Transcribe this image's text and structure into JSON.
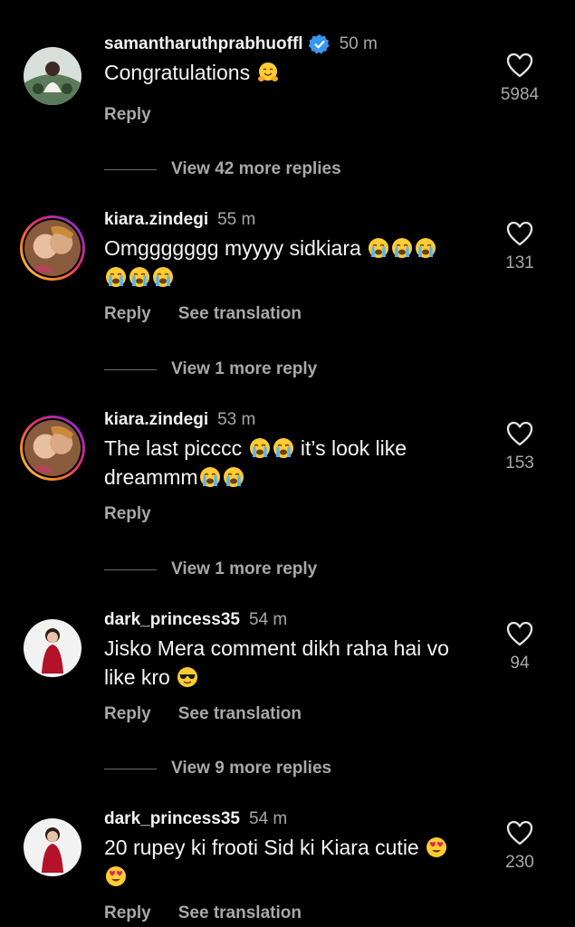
{
  "comments": [
    {
      "username": "samantharuthprabhuoffl",
      "verified": true,
      "time": "50 m",
      "text_parts": [
        "Congratulations "
      ],
      "likes": "5984",
      "reply_label": "Reply",
      "see_translation": ""
    },
    {
      "username": "kiara.zindegi",
      "verified": false,
      "time": "55 m",
      "text_parts": [
        "Omggggggg myyyy sidkiara "
      ],
      "likes": "131",
      "reply_label": "Reply",
      "see_translation": "See translation"
    },
    {
      "username": "kiara.zindegi",
      "verified": false,
      "time": "53 m",
      "text_parts": [
        "The last picccc ",
        " it’s look like dreammm"
      ],
      "likes": "153",
      "reply_label": "Reply",
      "see_translation": ""
    },
    {
      "username": "dark_princess35",
      "verified": false,
      "time": "54 m",
      "text_parts": [
        "Jisko Mera comment dikh raha hai vo like kro "
      ],
      "likes": "94",
      "reply_label": "Reply",
      "see_translation": "See translation"
    },
    {
      "username": "dark_princess35",
      "verified": false,
      "time": "54 m",
      "text_parts": [
        "20 rupey ki frooti Sid ki Kiara cutie "
      ],
      "likes": "230",
      "reply_label": "Reply",
      "see_translation": "See translation"
    }
  ],
  "view_more": [
    "View 42 more replies",
    "View 1 more reply",
    "View 1 more reply",
    "View 9 more replies"
  ],
  "icons": {
    "heart": "heart-outline-icon",
    "verified": "verified-badge-icon",
    "emojis": [
      "hugging-face",
      "loudly-crying-face",
      "smiling-face-with-sunglasses",
      "smiling-face-with-heart-eyes"
    ]
  },
  "colors": {
    "background": "#000000",
    "text": "#f5f5f5",
    "secondary": "#a8a8a8",
    "verified": "#3897f0"
  }
}
